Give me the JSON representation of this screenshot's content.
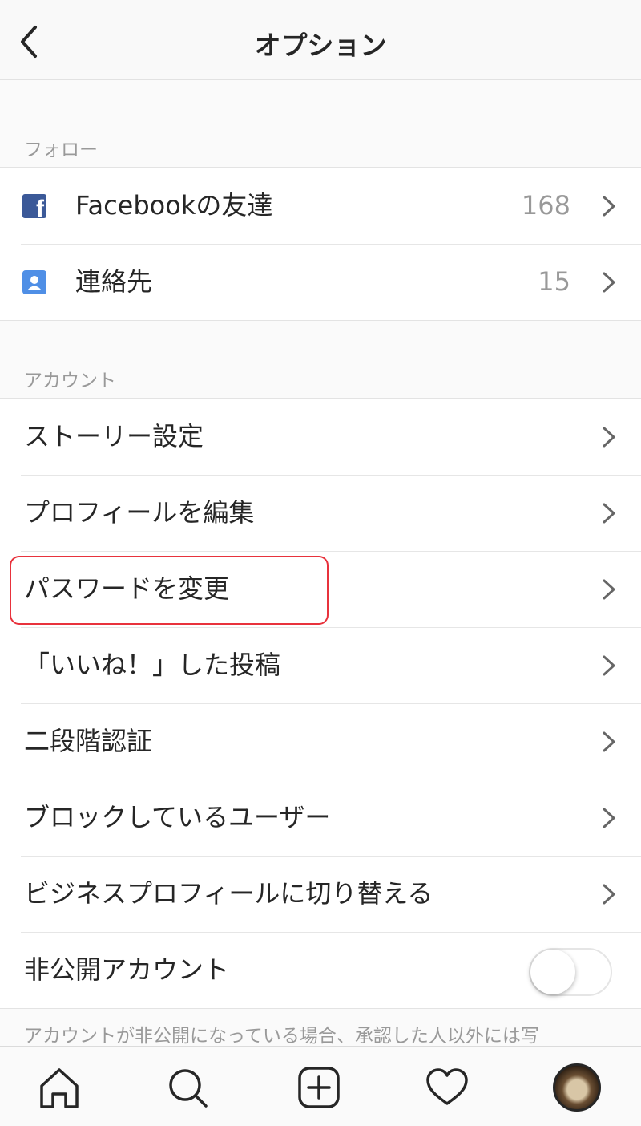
{
  "header": {
    "title": "オプション",
    "back_icon": "chevron-left-icon"
  },
  "follow_section": {
    "title": "フォロー",
    "items": [
      {
        "label": "Facebookの友達",
        "count": "168",
        "icon": "facebook-icon"
      },
      {
        "label": "連絡先",
        "count": "15",
        "icon": "contacts-icon"
      }
    ]
  },
  "account_section": {
    "title": "アカウント",
    "items": [
      {
        "label": "ストーリー設定"
      },
      {
        "label": "プロフィールを編集"
      },
      {
        "label": "パスワードを変更"
      },
      {
        "label": "「いいね！」した投稿"
      },
      {
        "label": "二段階認証"
      },
      {
        "label": "ブロックしているユーザー"
      },
      {
        "label": "ビジネスプロフィールに切り替える"
      },
      {
        "label": "非公開アカウント",
        "toggle": false
      }
    ],
    "note": "アカウントが非公開になっている場合、承認した人以外には写"
  },
  "tabbar": {
    "items": [
      "home-icon",
      "search-icon",
      "add-post-icon",
      "activity-heart-icon",
      "profile-avatar"
    ]
  },
  "colors": {
    "highlight": "#e8323c",
    "facebook": "#3b5998",
    "contacts": "#4f8fe6"
  }
}
